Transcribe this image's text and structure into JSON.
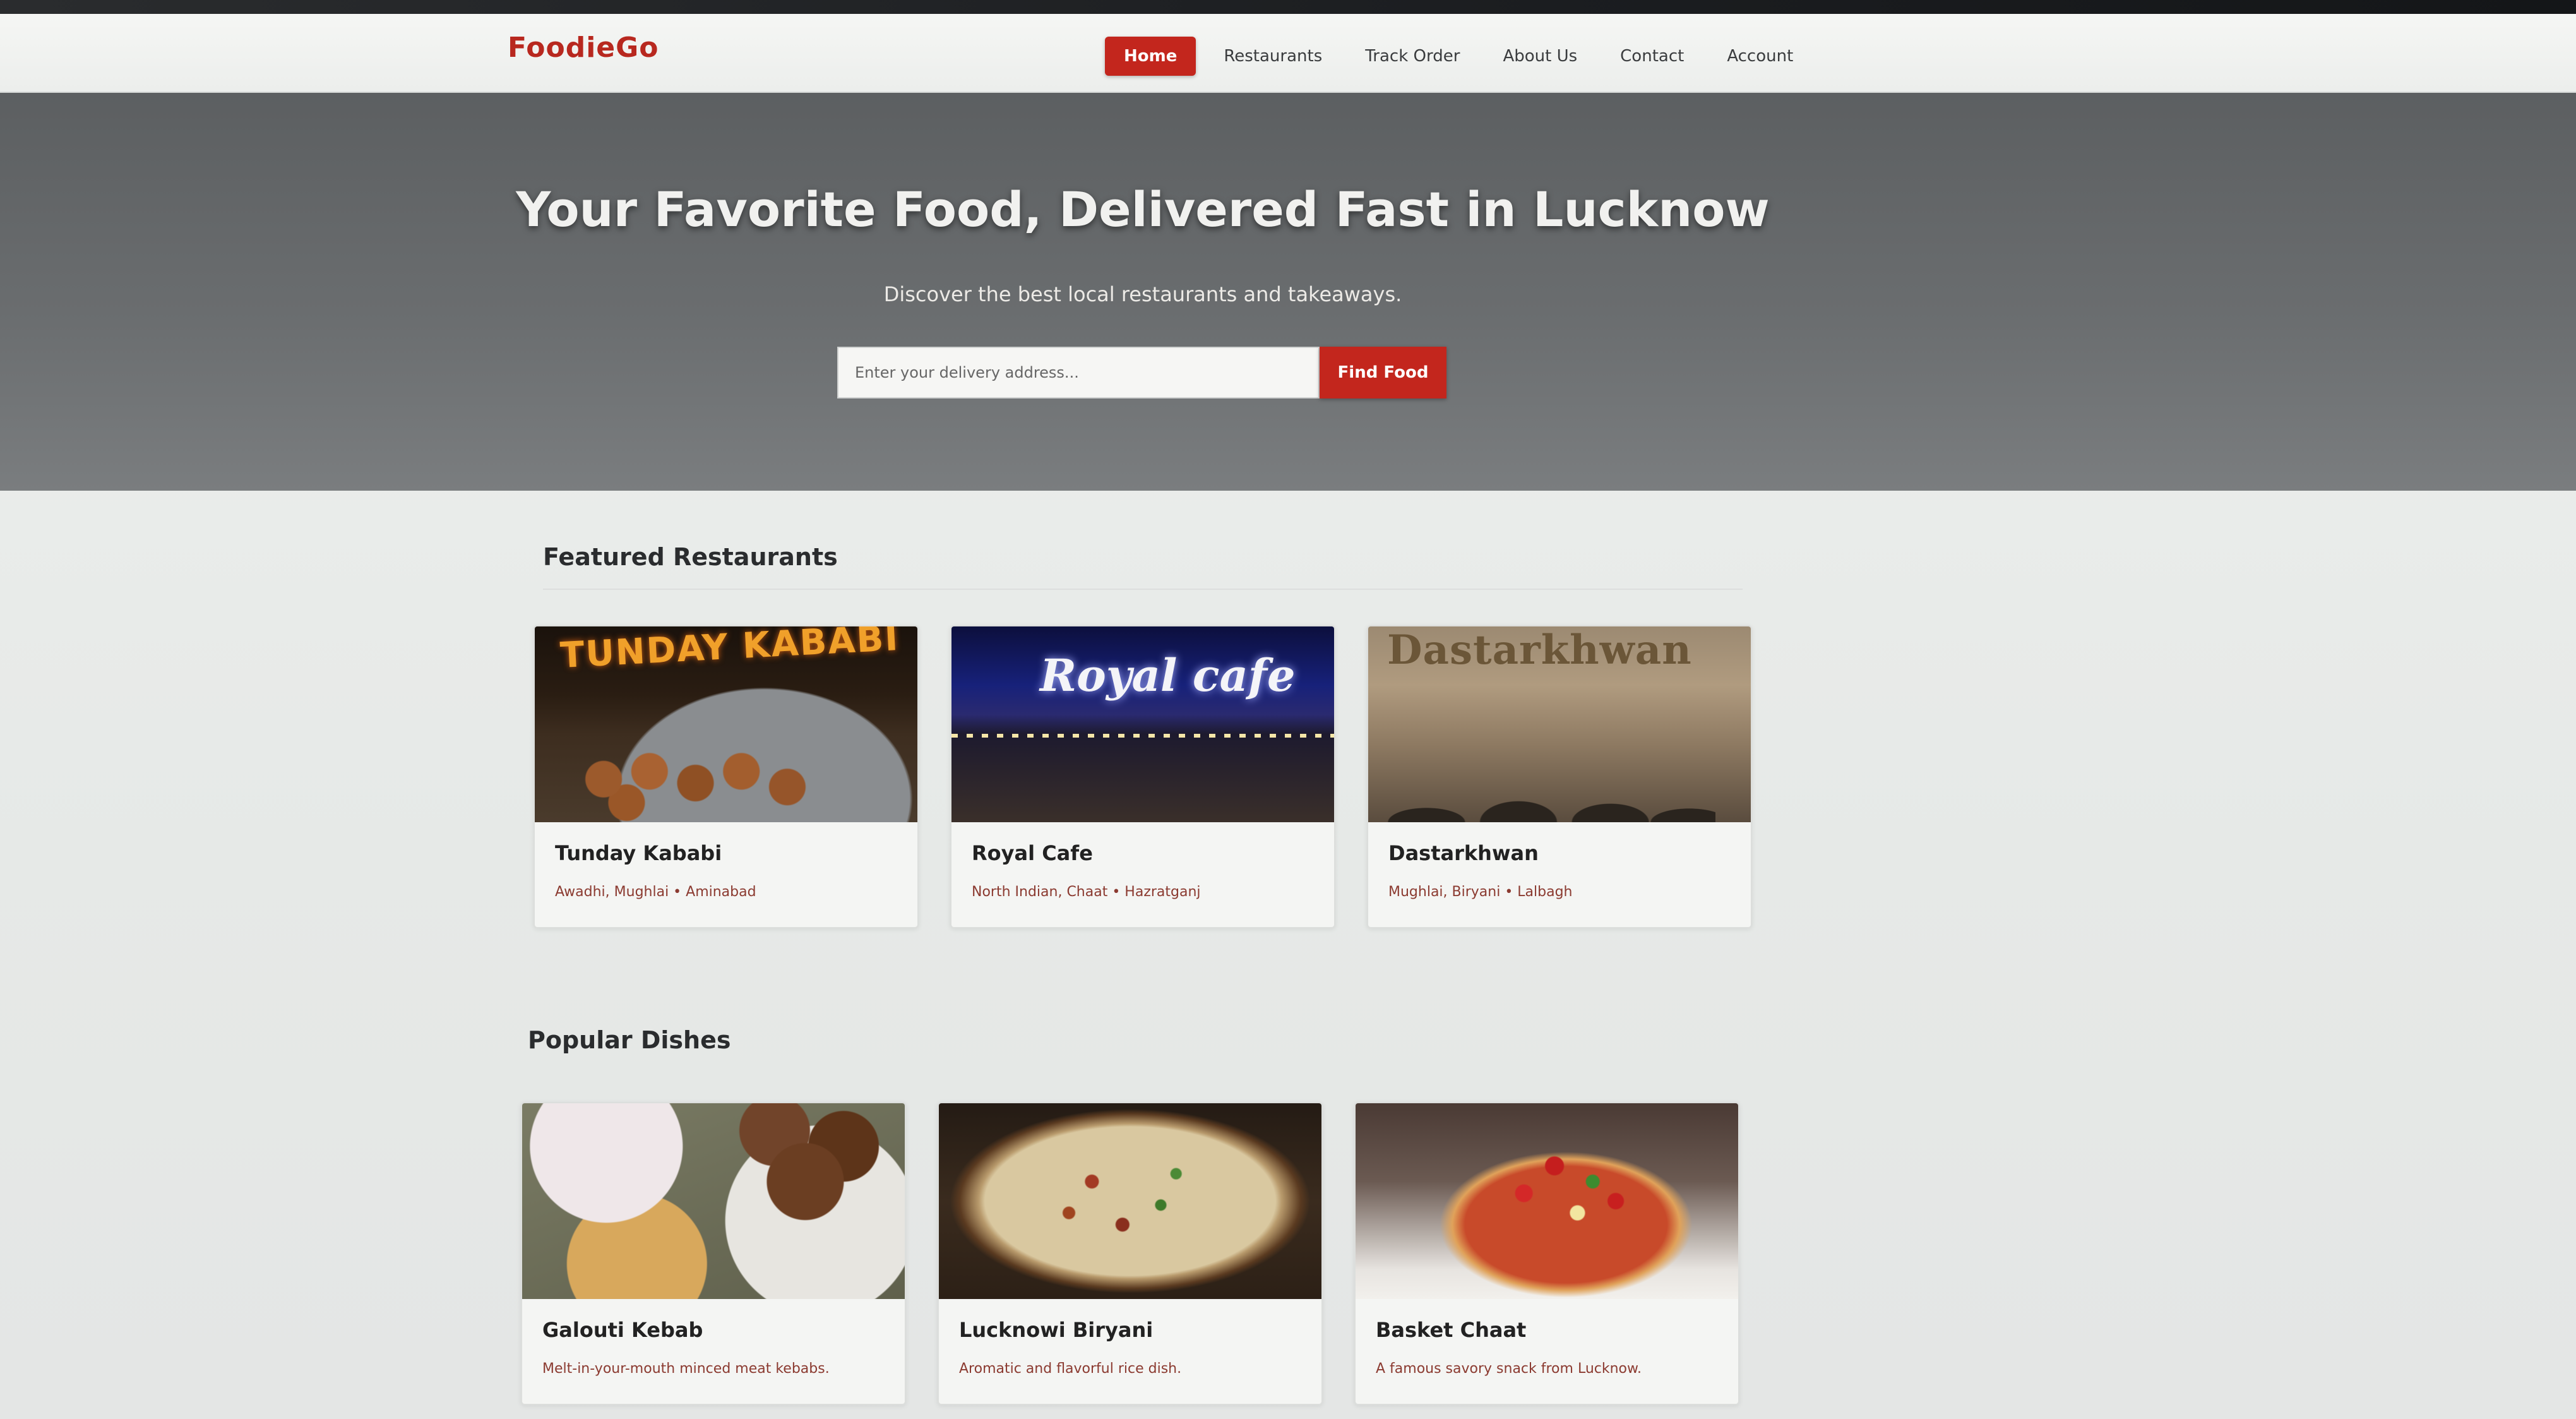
{
  "brand": "FoodieGo",
  "nav": {
    "items": [
      {
        "label": "Home",
        "active": true
      },
      {
        "label": "Restaurants",
        "active": false
      },
      {
        "label": "Track Order",
        "active": false
      },
      {
        "label": "About Us",
        "active": false
      },
      {
        "label": "Contact",
        "active": false
      },
      {
        "label": "Account",
        "active": false
      }
    ]
  },
  "hero": {
    "title": "Your Favorite Food, Delivered Fast in Lucknow",
    "subtitle": "Discover the best local restaurants and takeaways.",
    "search_placeholder": "Enter your delivery address...",
    "button_label": "Find Food"
  },
  "featured": {
    "title": "Featured Restaurants",
    "cards": [
      {
        "name": "Tunday Kababi",
        "desc": "Awadhi, Mughlai • Aminabad",
        "image": "tunday-kababi-photo",
        "sign": "TUNDAY KABABI"
      },
      {
        "name": "Royal Cafe",
        "desc": "North Indian, Chaat • Hazratganj",
        "image": "royal-cafe-photo",
        "sign": "Royal cafe"
      },
      {
        "name": "Dastarkhwan",
        "desc": "Mughlai, Biryani • Lalbagh",
        "image": "dastarkhwan-photo",
        "sign": "Dastarkhwan"
      }
    ]
  },
  "popular": {
    "title": "Popular Dishes",
    "cards": [
      {
        "name": "Galouti Kebab",
        "desc": "Melt-in-your-mouth minced meat kebabs.",
        "image": "galouti-kebab-photo"
      },
      {
        "name": "Lucknowi Biryani",
        "desc": "Aromatic and flavorful rice dish.",
        "image": "lucknowi-biryani-photo"
      },
      {
        "name": "Basket Chaat",
        "desc": "A famous savory snack from Lucknow.",
        "image": "basket-chaat-photo"
      }
    ]
  },
  "colors": {
    "brand": "#b8281f",
    "accent": "#c3261d",
    "hero_bg": "#666a6c"
  }
}
